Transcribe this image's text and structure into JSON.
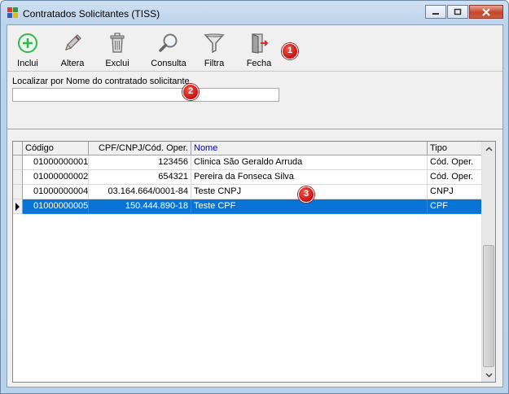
{
  "window": {
    "title": "Contratados Solicitantes (TISS)"
  },
  "toolbar": {
    "buttons": [
      {
        "label": "Inclui",
        "icon": "add-circle-icon"
      },
      {
        "label": "Altera",
        "icon": "pencil-icon"
      },
      {
        "label": "Exclui",
        "icon": "trash-icon"
      },
      {
        "label": "Consulta",
        "icon": "magnifier-icon"
      },
      {
        "label": "Filtra",
        "icon": "funnel-icon"
      },
      {
        "label": "Fecha",
        "icon": "door-exit-icon"
      }
    ]
  },
  "search": {
    "label": "Localizar por Nome do contratado solicitante",
    "value": ""
  },
  "badges": [
    "1",
    "2",
    "3"
  ],
  "grid": {
    "columns": [
      "Código",
      "CPF/CNPJ/Cód. Oper.",
      "Nome",
      "Tipo"
    ],
    "rows": [
      {
        "codigo": "01000000001",
        "doc": "123456",
        "nome": "Clinica São Geraldo Arruda",
        "tipo": "Cód. Oper."
      },
      {
        "codigo": "01000000002",
        "doc": "654321",
        "nome": "Pereira da Fonseca Silva",
        "tipo": "Cód. Oper."
      },
      {
        "codigo": "01000000004",
        "doc": "03.164.664/0001-84",
        "nome": "Teste CNPJ",
        "tipo": "CNPJ"
      },
      {
        "codigo": "01000000005",
        "doc": "150.444.890-18",
        "nome": "Teste CPF",
        "tipo": "CPF"
      }
    ],
    "selected_row": 3,
    "sorted_column": "Nome"
  },
  "colors": {
    "selection": "#0a73d6",
    "badge": "#d42020",
    "sorted_header_text": "#0000c0"
  }
}
